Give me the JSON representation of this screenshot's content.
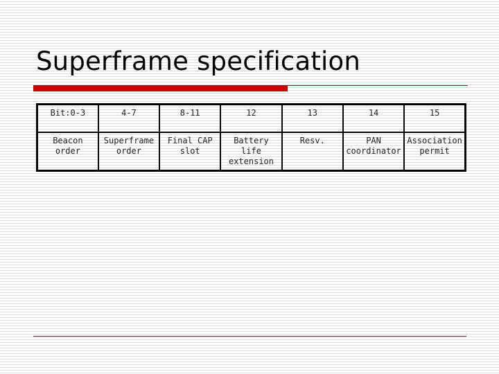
{
  "slide": {
    "title": "Superframe specification"
  },
  "table": {
    "bits": [
      "Bit:0-3",
      "4-7",
      "8-11",
      "12",
      "13",
      "14",
      "15"
    ],
    "fields": [
      [
        "Beacon",
        "order"
      ],
      [
        "Superframe",
        "order"
      ],
      [
        "Final CAP",
        "slot"
      ],
      [
        "Battery life",
        "extension"
      ],
      [
        "Resv.",
        ""
      ],
      [
        "PAN",
        "coordinator"
      ],
      [
        "Association",
        "permit"
      ]
    ]
  },
  "colors": {
    "accent_red": "#cc0000",
    "rule_dark_red": "#7a1a22"
  }
}
